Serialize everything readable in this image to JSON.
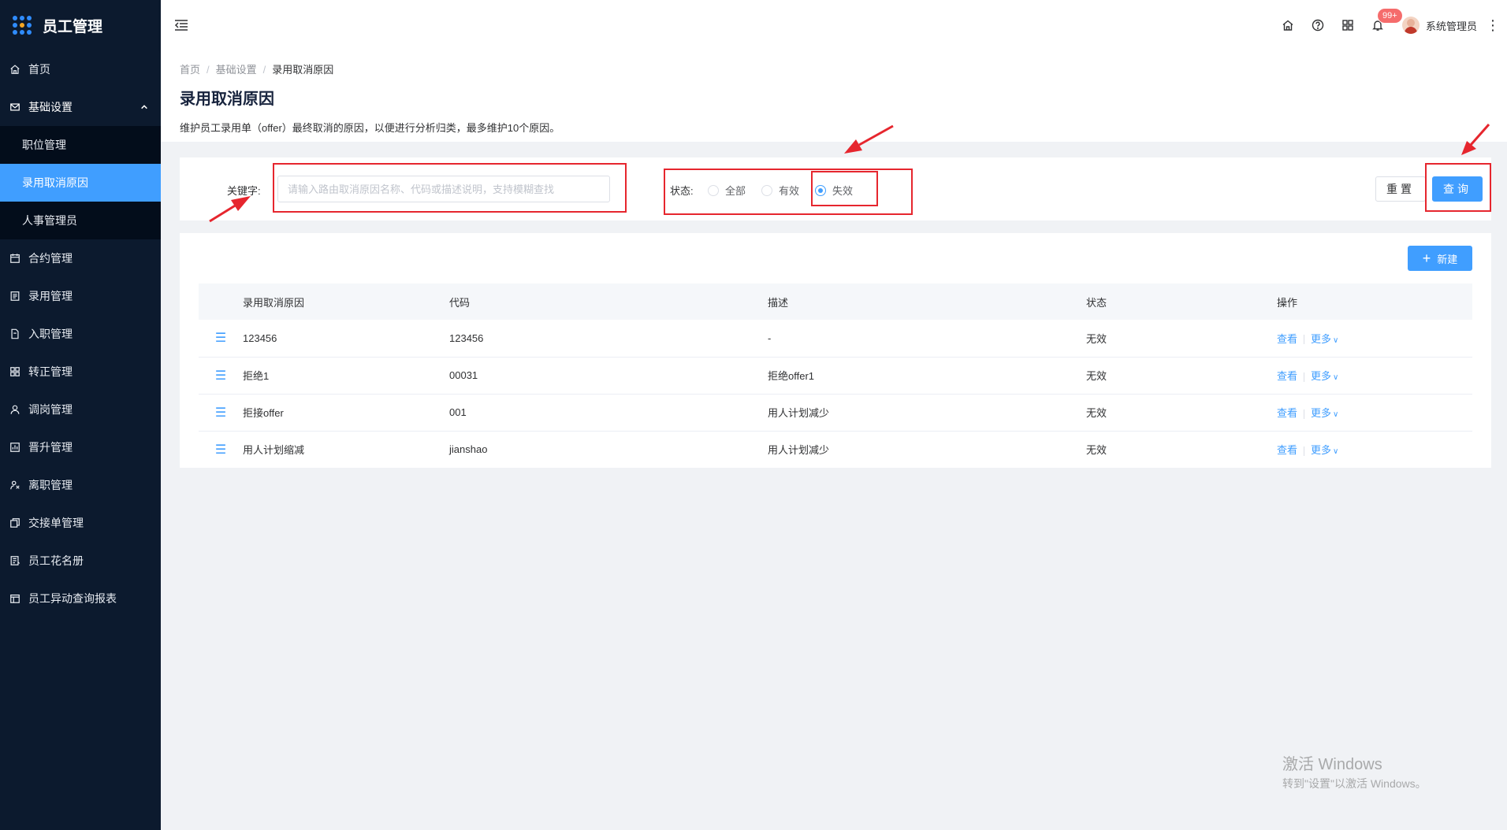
{
  "app": {
    "title": "员工管理"
  },
  "sidebar": {
    "items": [
      {
        "label": "首页",
        "icon": "home-icon"
      },
      {
        "label": "基础设置",
        "icon": "mail-icon",
        "expanded": true,
        "children": [
          {
            "label": "职位管理",
            "active": false
          },
          {
            "label": "录用取消原因",
            "active": true
          },
          {
            "label": "人事管理员",
            "active": false
          }
        ]
      },
      {
        "label": "合约管理",
        "icon": "calendar-icon"
      },
      {
        "label": "录用管理",
        "icon": "document-icon"
      },
      {
        "label": "入职管理",
        "icon": "file-icon"
      },
      {
        "label": "转正管理",
        "icon": "grid-icon"
      },
      {
        "label": "调岗管理",
        "icon": "user-icon"
      },
      {
        "label": "晋升管理",
        "icon": "chart-icon"
      },
      {
        "label": "离职管理",
        "icon": "exit-icon"
      },
      {
        "label": "交接单管理",
        "icon": "copy-icon"
      },
      {
        "label": "员工花名册",
        "icon": "roster-icon"
      },
      {
        "label": "员工异动查询报表",
        "icon": "report-icon"
      }
    ]
  },
  "header": {
    "badge": "99+",
    "user_name": "系统管理员"
  },
  "breadcrumb": [
    "首页",
    "基础设置",
    "录用取消原因"
  ],
  "page": {
    "title": "录用取消原因",
    "description": "维护员工录用单（offer）最终取消的原因，以便进行分析归类，最多维护10个原因。"
  },
  "filter": {
    "keyword_label": "关键字:",
    "keyword_value": "",
    "keyword_placeholder": "请输入路由取消原因名称、代码或描述说明，支持模糊查找",
    "status_label": "状态:",
    "status_options": [
      "全部",
      "有效",
      "失效"
    ],
    "status_selected": "失效",
    "reset_label": "重置",
    "query_label": "查询"
  },
  "table": {
    "new_label": "新建",
    "columns": [
      "录用取消原因",
      "代码",
      "描述",
      "状态",
      "操作"
    ],
    "rows": [
      {
        "reason": "123456",
        "code": "123456",
        "desc": "-",
        "status": "无效"
      },
      {
        "reason": "拒绝1",
        "code": "00031",
        "desc": "拒绝offer1",
        "status": "无效"
      },
      {
        "reason": "拒接offer",
        "code": "001",
        "desc": "用人计划减少",
        "status": "无效"
      },
      {
        "reason": "用人计划缩减",
        "code": "jianshao",
        "desc": "用人计划减少",
        "status": "无效"
      }
    ],
    "view_label": "查看",
    "more_label": "更多"
  },
  "watermark": {
    "line1": "激活 Windows",
    "line2": "转到\"设置\"以激活 Windows。"
  },
  "colors": {
    "sidebar_bg": "#0c1a2e",
    "primary": "#409eff",
    "annotation": "#e6262e",
    "badge": "#f56c6c"
  }
}
